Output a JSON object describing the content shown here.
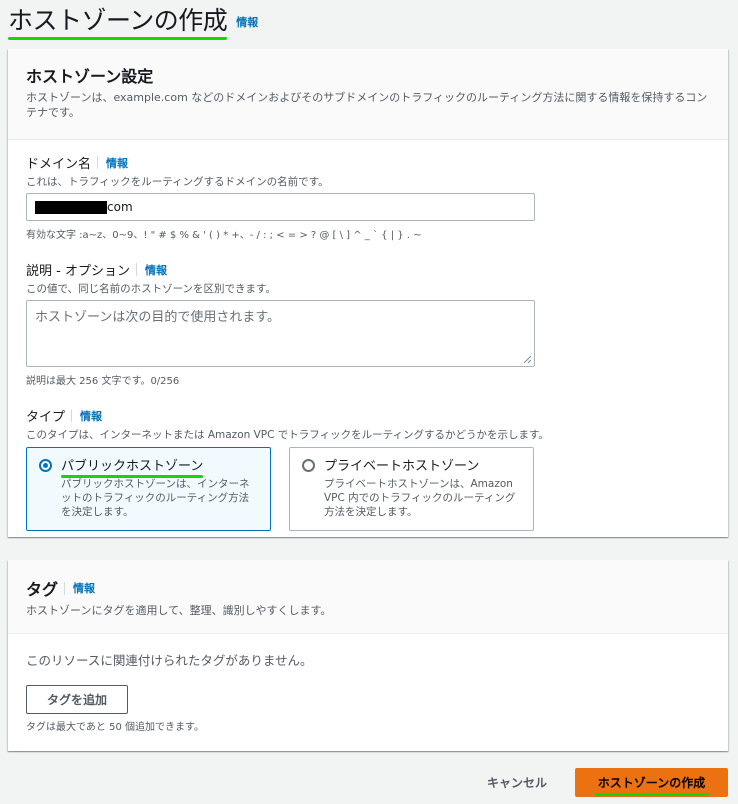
{
  "page": {
    "title": "ホストゾーンの作成",
    "info_link": "情報"
  },
  "hosted_zone_settings": {
    "title": "ホストゾーン設定",
    "description": "ホストゾーンは、example.com などのドメインおよびそのサブドメインのトラフィックのルーティング方法に関する情報を保持するコンテナです。",
    "domain_name": {
      "label": "ドメイン名",
      "info": "情報",
      "hint": "これは、トラフィックをルーティングするドメインの名前です。",
      "value_suffix": "com",
      "value_redacted": true,
      "constraint": "有効な文字 :a~z、0~9、! \" # $ % & ' ( ) * +、- / : ; < = > ? @ [ \\ ] ^ _ ` { | } . ~"
    },
    "description_field": {
      "label": "説明 - オプション",
      "info": "情報",
      "hint": "この値で、同じ名前のホストゾーンを区別できます。",
      "placeholder": "ホストゾーンは次の目的で使用されます。",
      "counter": "説明は最大 256 文字です。0/256"
    },
    "type": {
      "label": "タイプ",
      "info": "情報",
      "hint": "このタイプは、インターネットまたは Amazon VPC でトラフィックをルーティングするかどうかを示します。",
      "options": [
        {
          "title": "パブリックホストゾーン",
          "description": "パブリックホストゾーンは、インターネットのトラフィックのルーティング方法を決定します。",
          "selected": true
        },
        {
          "title": "プライベートホストゾーン",
          "description": "プライベートホストゾーンは、Amazon VPC 内でのトラフィックのルーティング方法を決定します。",
          "selected": false
        }
      ]
    }
  },
  "tags": {
    "title": "タグ",
    "info": "情報",
    "description": "ホストゾーンにタグを適用して、整理、識別しやすくします。",
    "empty_text": "このリソースに関連付けられたタグがありません。",
    "add_button": "タグを追加",
    "limit_text": "タグは最大であと 50 個追加できます。"
  },
  "footer": {
    "cancel": "キャンセル",
    "create": "ホストゾーンの作成"
  },
  "colors": {
    "accent_link": "#0073bb",
    "primary_button": "#ec7211",
    "highlight_underline": "#16d60b"
  }
}
